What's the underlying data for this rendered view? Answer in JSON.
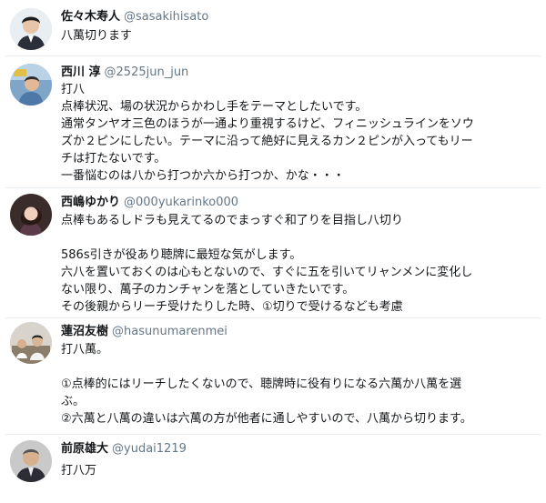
{
  "tweets": [
    {
      "name": "佐々木寿人",
      "handle": "@sasakihisato",
      "lines": [
        "八萬切ります"
      ]
    },
    {
      "name": "西川 淳",
      "handle": "@2525jun_jun",
      "lines": [
        "打八",
        "点棒状況、場の状況からかわし手をテーマとしたいです。",
        "通常タンヤオ三色のほうが一通より重視するけど、フィニッシュラインをソウ",
        "ズか２ピンにしたい。テーマに沿って絶好に見えるカン２ピンが入ってもリー",
        "チは打たないです。",
        "一番悩むのは八から打つか六から打つか、かな・・・"
      ]
    },
    {
      "name": "西嶋ゆかり",
      "handle": "@000yukarinko000",
      "lines": [
        "点棒もあるしドラも見えてるのでまっすぐ和了りを目指し八切り",
        "",
        "586s引きが役あり聴牌に最短な気がします。",
        "六八を置いておくのは心もとないので、すぐに五を引いてリャンメンに変化し",
        "ない限り、萬子のカンチャンを落としていきたいです。",
        "その後親からリーチ受けたりした時、①切りで受けるなども考慮"
      ]
    },
    {
      "name": "蓮沼友樹",
      "handle": "@hasunumarenmei",
      "lines": [
        "打八萬。",
        "",
        "①点棒的にはリーチしたくないので、聴牌時に役有りになる六萬か八萬を選",
        "ぶ。",
        "②六萬と八萬の違いは六萬の方が他者に通しやすいので、八萬から切ります。"
      ]
    },
    {
      "name": "前原雄大",
      "handle": "@yudai1219",
      "lines": [
        "打八万"
      ]
    }
  ]
}
